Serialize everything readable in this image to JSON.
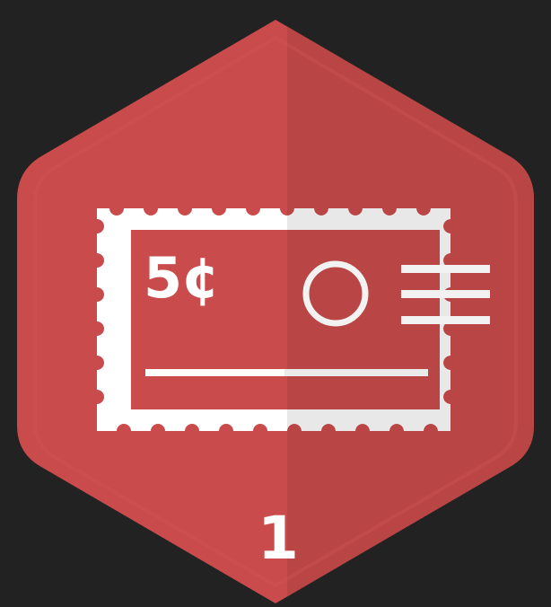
{
  "badge": {
    "stamp_value": "5¢",
    "level": "1",
    "icon": "postage-stamp-icon"
  },
  "colors": {
    "background": "#222222",
    "badge_left": "#ca4b4b",
    "badge_right": "#b94545",
    "badge_outline": "#c04848",
    "stamp": "#ffffff",
    "stamp_shaded": "#e9e9e9"
  }
}
